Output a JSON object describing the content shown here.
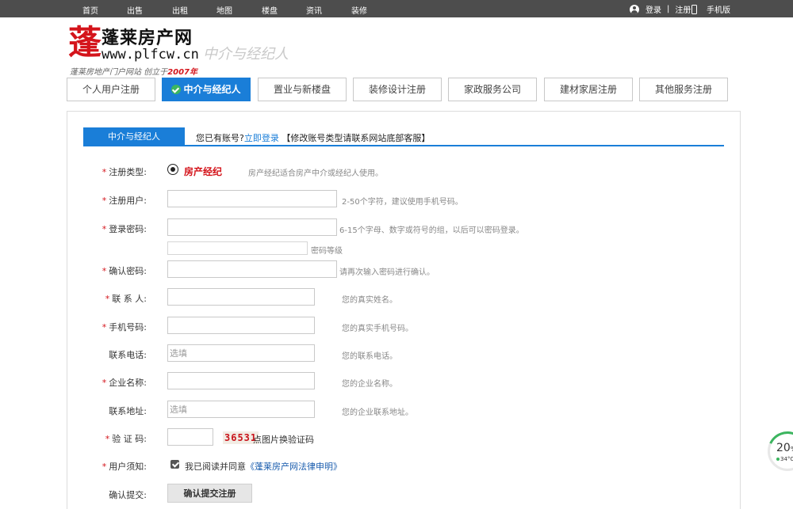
{
  "topbar": {
    "nav": [
      "首页",
      "出售",
      "出租",
      "地图",
      "楼盘",
      "资讯",
      "装修"
    ],
    "login": "登录",
    "sep": "|",
    "register": "注册",
    "mobile": "手机版"
  },
  "logo": {
    "glyph": "蓬",
    "name": "蓬莱房产网",
    "url": "www.plfcw.cn",
    "subtitle": "中介与经纪人",
    "slogan_prefix": "蓬莱房地产门户网站  创立于",
    "slogan_year": "2007年"
  },
  "category_tabs": [
    {
      "label": "个人用户注册",
      "active": false
    },
    {
      "label": "中介与经纪人",
      "active": true
    },
    {
      "label": "置业与新楼盘",
      "active": false
    },
    {
      "label": "装修设计注册",
      "active": false
    },
    {
      "label": "家政服务公司",
      "active": false
    },
    {
      "label": "建材家居注册",
      "active": false
    },
    {
      "label": "其他服务注册",
      "active": false
    }
  ],
  "form_tab": {
    "label": "中介与经纪人",
    "have_account": "您已有账号?",
    "login_now": "立即登录",
    "modify_note": " 【修改账号类型请联系网站底部客服】"
  },
  "form": {
    "type": {
      "label": "注册类型:",
      "option": "房产经纪",
      "hint": "房产经纪适合房产中介或经纪人使用。"
    },
    "username": {
      "label": "注册用户:",
      "value": "",
      "hint": "2-50个字符，建议使用手机号码。"
    },
    "password": {
      "label": "登录密码:",
      "value": "",
      "hint": "6-15个字母、数字或符号的组，以后可以密码登录。",
      "strength": "密码等级"
    },
    "confirm": {
      "label": "确认密码:",
      "value": "",
      "hint": "请再次输入密码进行确认。"
    },
    "contact": {
      "label": "联 系 人:",
      "value": "",
      "hint": "您的真实姓名。"
    },
    "mobile": {
      "label": "手机号码:",
      "value": "",
      "hint": "您的真实手机号码。"
    },
    "phone": {
      "label": "联系电话:",
      "value": "",
      "placeholder": "选填",
      "hint": "您的联系电话。"
    },
    "company": {
      "label": "企业名称:",
      "value": "",
      "hint": "您的企业名称。"
    },
    "address": {
      "label": "联系地址:",
      "value": "",
      "placeholder": "选填",
      "hint": "您的企业联系地址。"
    },
    "captcha": {
      "label": "验 证 码:",
      "value": "",
      "code": "36531",
      "hint": "点图片换验证码"
    },
    "terms": {
      "label": "用户须知:",
      "text": "我已阅读并同意",
      "link": "《蓬莱房产网法律申明》"
    },
    "submit": {
      "label": "确认提交:",
      "button": "确认提交注册"
    }
  },
  "widget": {
    "percent": "20",
    "percent_unit": "%",
    "temp": "34°C"
  }
}
